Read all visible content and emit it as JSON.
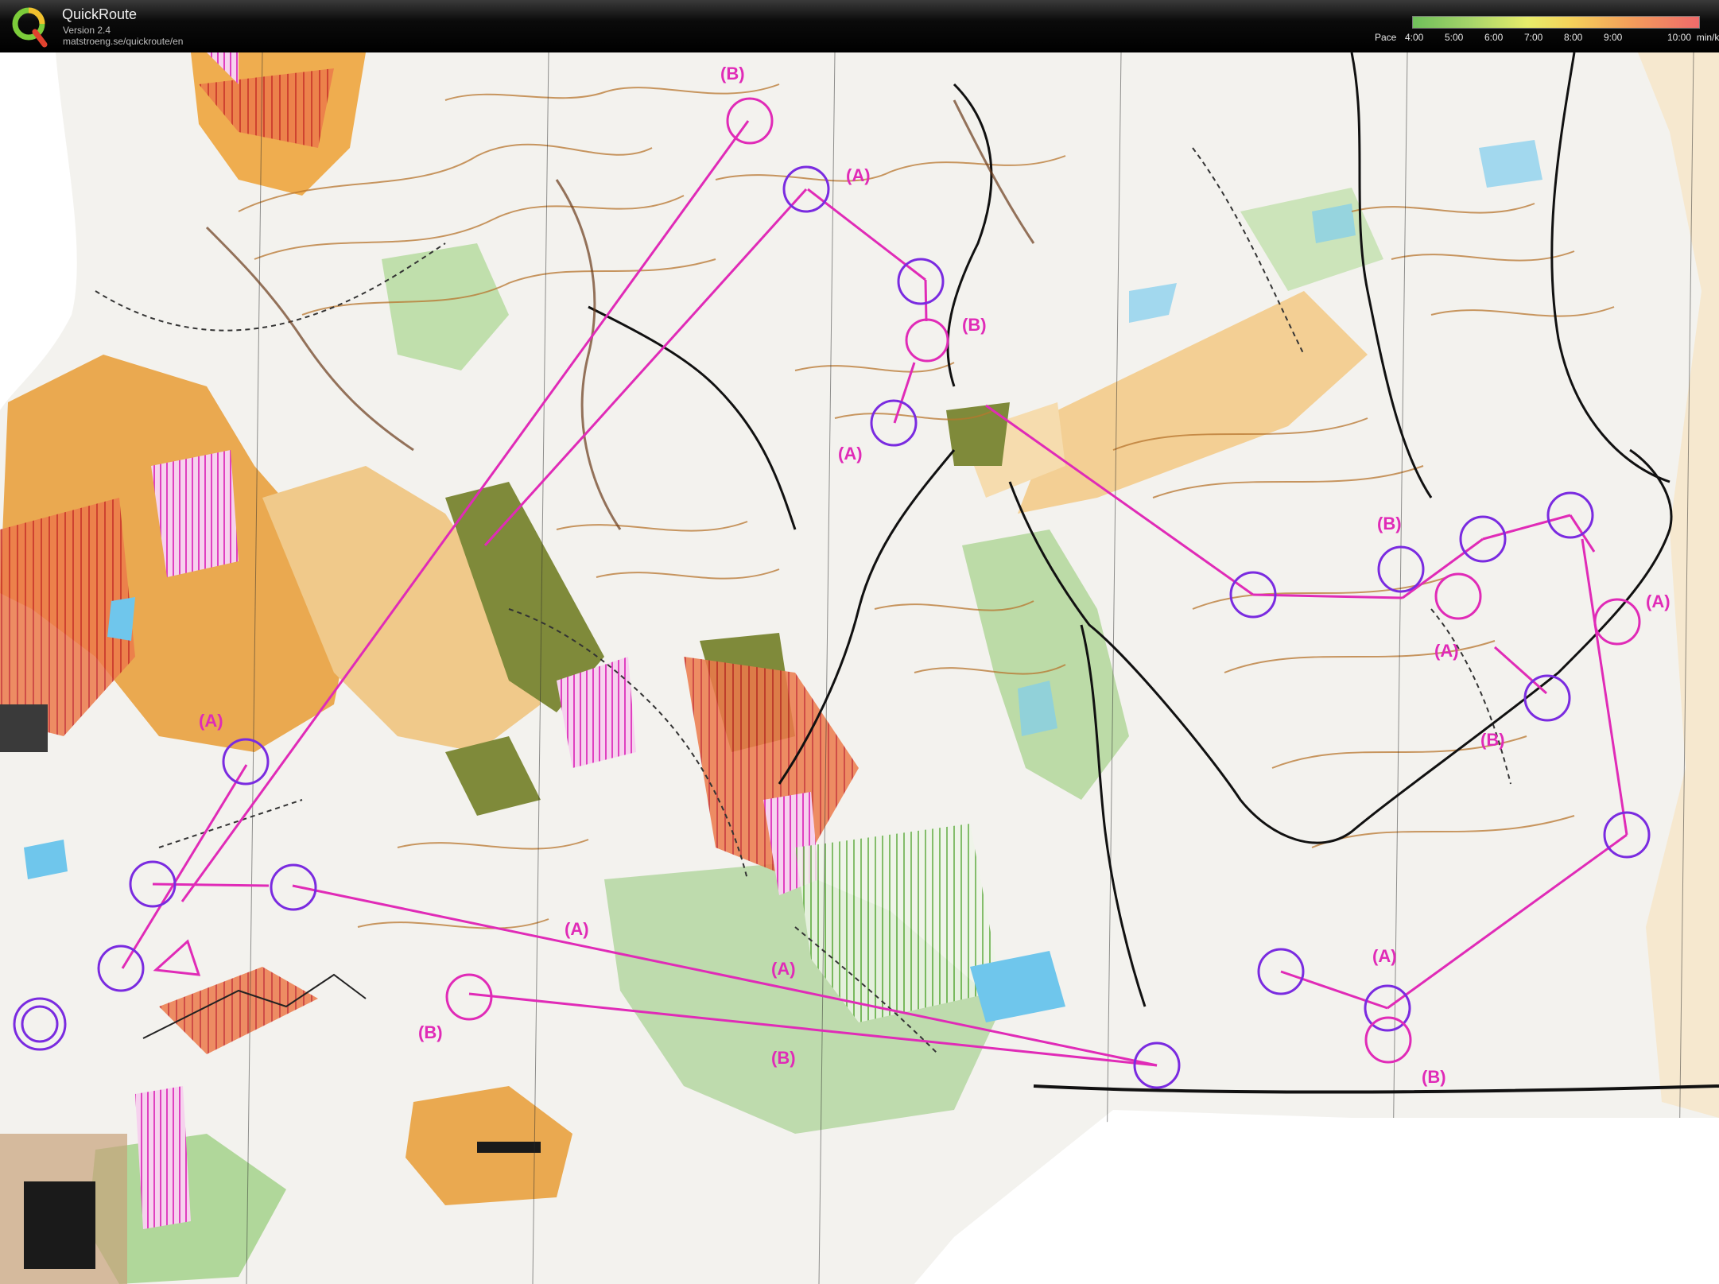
{
  "header": {
    "app_title": "QuickRoute",
    "version": "Version 2.4",
    "url": "matstroeng.se/quickroute/en",
    "logo_icon": "quickroute-q-logo"
  },
  "pace_legend": {
    "label": "Pace",
    "ticks": [
      "4:00",
      "5:00",
      "6:00",
      "7:00",
      "8:00",
      "9:00",
      "10:00"
    ],
    "unit": "min/km",
    "gradient_colors": [
      "#6fbf5a",
      "#a6d46a",
      "#e7ec6a",
      "#f4d25a",
      "#f3a05a",
      "#ee6a6a"
    ]
  },
  "map": {
    "type": "orienteering-map",
    "course_color": "#e02bb7",
    "control_color": "#7a2be0",
    "labels": {
      "b_top": "(B)",
      "a_top": "(A)",
      "b_mid": "(B)",
      "a_mid": "(A)",
      "a_left": "(A)",
      "a_center1": "(A)",
      "a_center2": "(A)",
      "b_center": "(B)",
      "b_left": "(B)",
      "b_right1": "(B)",
      "a_right1": "(A)",
      "a_right2": "(A)",
      "b_right2": "(B)",
      "a_bottom_right": "(A)",
      "b_bottom_right": "(B)"
    }
  }
}
